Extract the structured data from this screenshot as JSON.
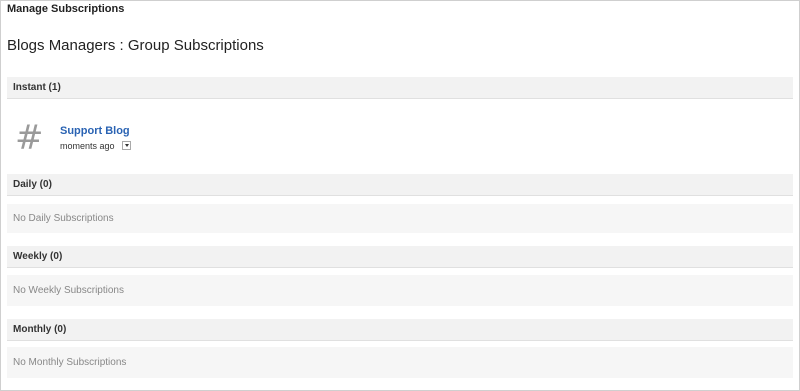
{
  "header": {
    "title": "Manage Subscriptions"
  },
  "page": {
    "title": "Blogs Managers : Group Subscriptions"
  },
  "sections": {
    "instant": {
      "label": "Instant (1)",
      "items": [
        {
          "title": "Support Blog",
          "time": "moments ago",
          "icon": "hash-icon"
        }
      ]
    },
    "daily": {
      "label": "Daily (0)",
      "empty": "No Daily Subscriptions"
    },
    "weekly": {
      "label": "Weekly (0)",
      "empty": "No Weekly Subscriptions"
    },
    "monthly": {
      "label": "Monthly (0)",
      "empty": "No Monthly Subscriptions"
    }
  },
  "colors": {
    "link": "#2a63b3",
    "header_bg": "#f2f2f2",
    "body_bg": "#f6f6f6",
    "muted_text": "#888888"
  }
}
